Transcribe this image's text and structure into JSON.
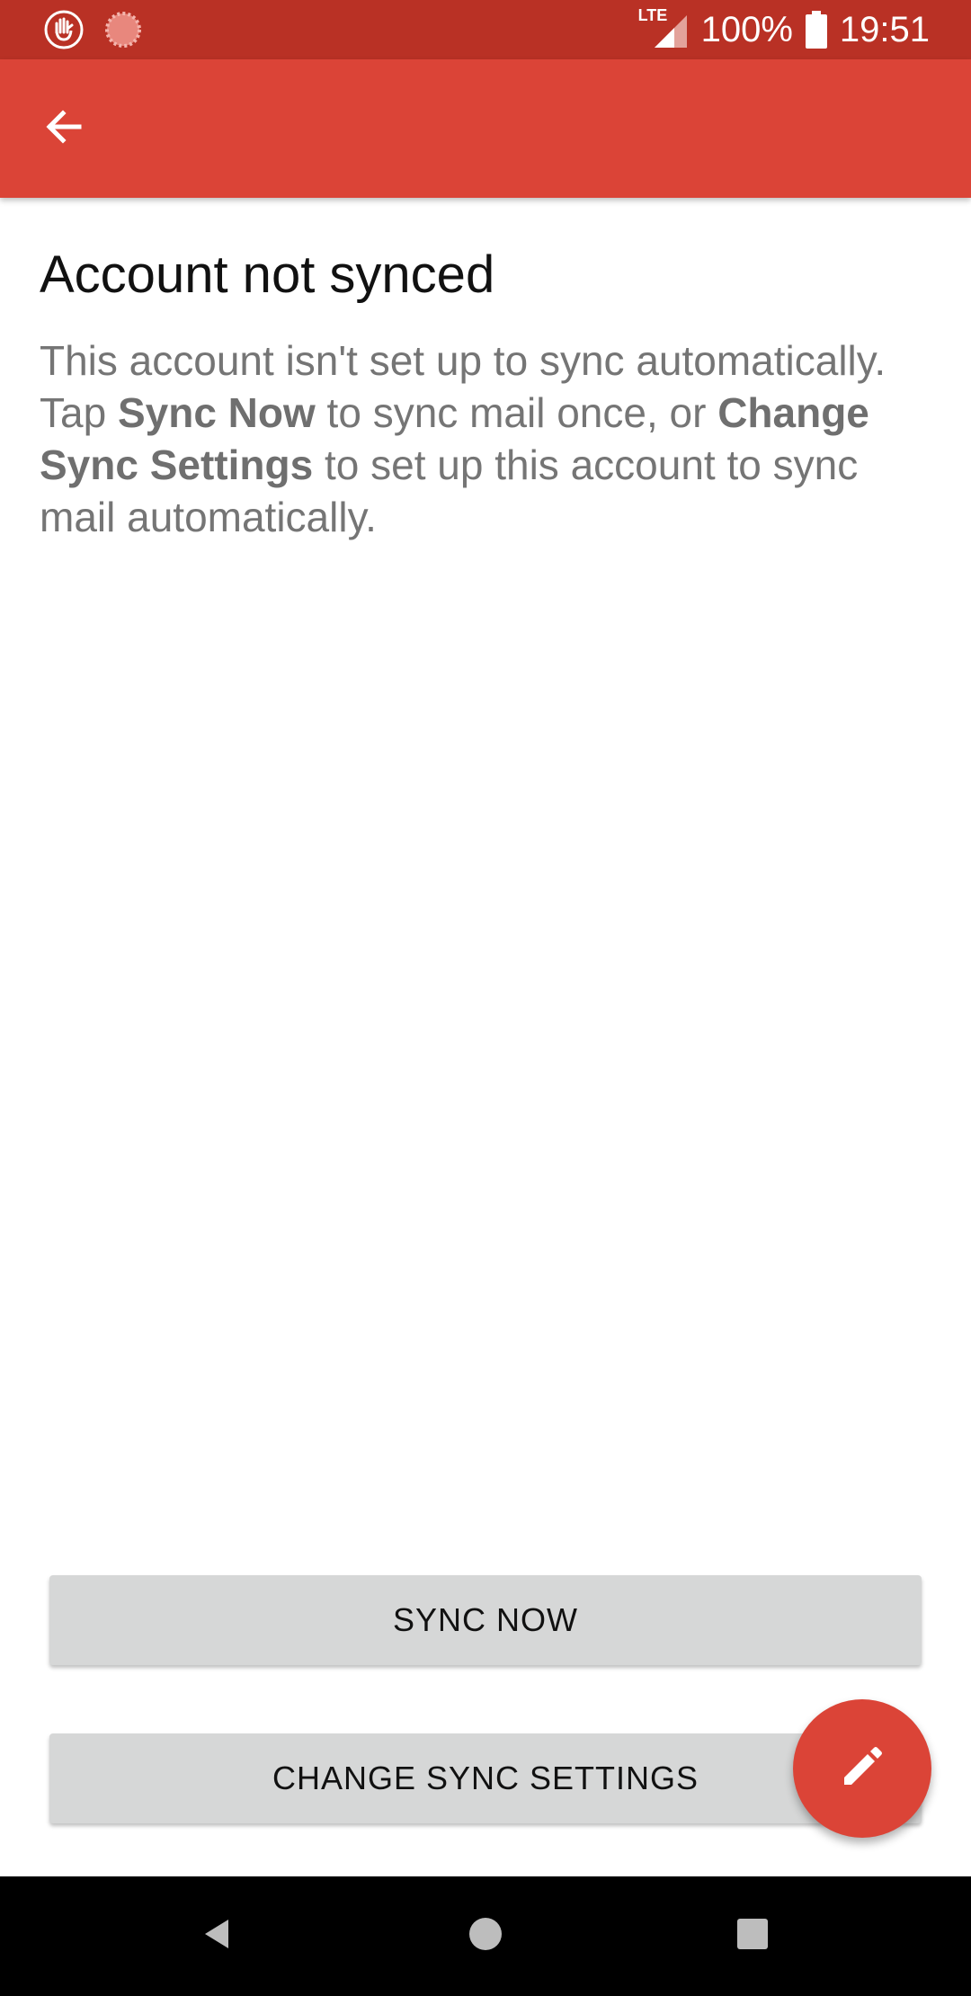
{
  "status_bar": {
    "left_icons": [
      "hand-stop-icon",
      "sync-spinner-icon"
    ],
    "network": "LTE",
    "battery": "100%",
    "time": "19:51"
  },
  "app_bar": {
    "back_icon": "arrow-back-icon"
  },
  "content": {
    "title": "Account not synced",
    "line1": "This account isn't set up to sync automatically.",
    "line2_prefix": "Tap ",
    "line2_bold1": "Sync Now",
    "line2_mid": " to sync mail once, or ",
    "line2_bold2": "Change Sync Settings",
    "line2_suffix": " to set up this account to sync mail automatically."
  },
  "buttons": {
    "sync_now": "SYNC NOW",
    "change_sync_settings": "CHANGE SYNC SETTINGS"
  },
  "fab": {
    "icon": "pencil-icon"
  },
  "nav_bar": {
    "icons": [
      "back-triangle-icon",
      "home-circle-icon",
      "recents-square-icon"
    ]
  },
  "colors": {
    "status_bar": "#b93125",
    "app_bar": "#db4437",
    "button_bg": "#d6d7d7",
    "fab": "#db4437"
  }
}
